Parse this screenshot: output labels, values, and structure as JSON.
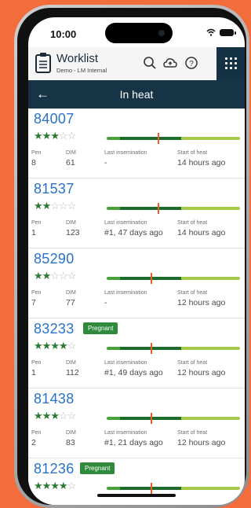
{
  "status_bar": {
    "time": "10:00"
  },
  "app_header": {
    "title": "Worklist",
    "subtitle": "Demo - LM Internal"
  },
  "title_bar": {
    "title": "In heat"
  },
  "columns": {
    "pen": "Pen",
    "dim": "DIM",
    "last_insemination": "Last insemination",
    "start_of_heat": "Start of heat"
  },
  "cows": [
    {
      "id": "84007",
      "stars": 3,
      "badge": "",
      "pen": "8",
      "dim": "61",
      "last_insemination": "-",
      "start_of_heat": "14 hours ago",
      "heat_marker_pct": 0.38
    },
    {
      "id": "81537",
      "stars": 2,
      "badge": "",
      "pen": "1",
      "dim": "123",
      "last_insemination": "#1, 47 days ago",
      "start_of_heat": "14 hours ago",
      "heat_marker_pct": 0.38
    },
    {
      "id": "85290",
      "stars": 2,
      "badge": "",
      "pen": "7",
      "dim": "77",
      "last_insemination": "-",
      "start_of_heat": "12 hours ago",
      "heat_marker_pct": 0.33
    },
    {
      "id": "83233",
      "stars": 4,
      "badge": "Pregnant",
      "pen": "1",
      "dim": "112",
      "last_insemination": "#1, 49 days ago",
      "start_of_heat": "12 hours ago",
      "heat_marker_pct": 0.33
    },
    {
      "id": "81438",
      "stars": 3,
      "badge": "",
      "pen": "2",
      "dim": "83",
      "last_insemination": "#1, 21 days ago",
      "start_of_heat": "12 hours ago",
      "heat_marker_pct": 0.33
    },
    {
      "id": "81236",
      "stars": 4,
      "badge": "Pregnant",
      "pen": "",
      "dim": "",
      "last_insemination": "",
      "start_of_heat": "",
      "heat_marker_pct": 0.33
    }
  ],
  "colors": {
    "accent_blue": "#2a72c9",
    "navy": "#163446",
    "star_on": "#2c7a33",
    "heat_marker": "#f05a28",
    "badge_green": "#2f8a3b"
  },
  "icons": {
    "header": [
      "clipboard-icon",
      "search-icon",
      "cloud-sync-icon",
      "help-icon",
      "grid-menu-icon"
    ],
    "back": "back-arrow-icon"
  }
}
